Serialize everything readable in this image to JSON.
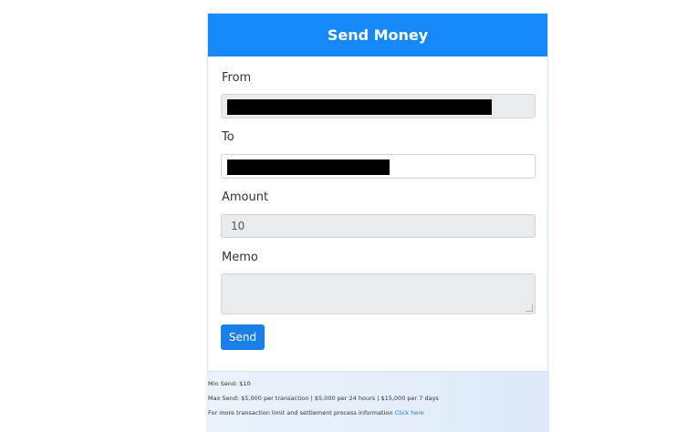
{
  "header": {
    "title": "Send Money"
  },
  "form": {
    "from_label": "From",
    "to_label": "To",
    "amount_label": "Amount",
    "amount_value": "10",
    "memo_label": "Memo",
    "memo_value": "",
    "send_label": "Send"
  },
  "footer": {
    "min_send": "Min Send: $10",
    "max_send": "Max Send: $5,000 per transaction | $5,000 per 24 hours | $15,000 per 7 days",
    "info_text": "For more transaction limit and settlement process information ",
    "info_link": "Click here"
  },
  "colors": {
    "header_bg": "#1689fa",
    "button_bg": "#1a7fe8",
    "readonly_field_bg": "#e9ecef",
    "link": "#1a7fe8"
  }
}
